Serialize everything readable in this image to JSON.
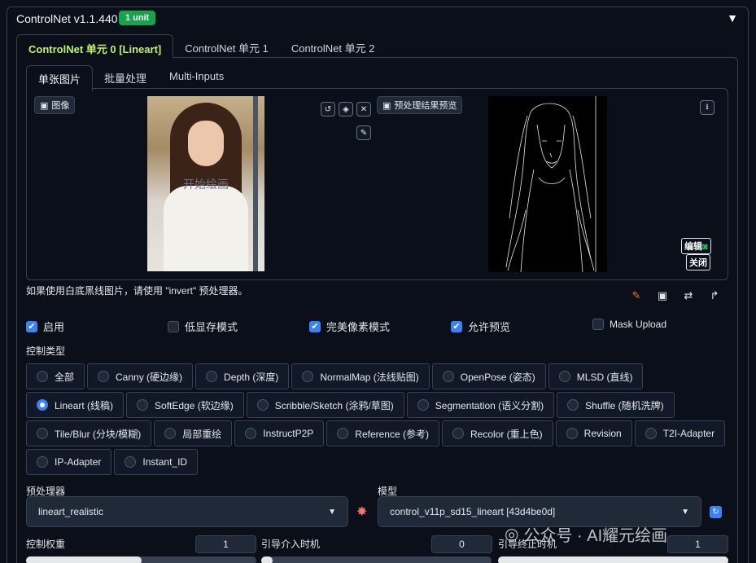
{
  "header": {
    "title": "ControlNet v1.1.440",
    "badge": "1 unit",
    "collapse_icon": "triangle-down-icon"
  },
  "unit_tabs": [
    "ControlNet 单元 0 [Lineart]",
    "ControlNet 单元 1",
    "ControlNet 单元 2"
  ],
  "sub_tabs": [
    "单张图片",
    "批量处理",
    "Multi-Inputs"
  ],
  "input_image": {
    "label": "图像",
    "overlay_text": "开始绘画"
  },
  "preview": {
    "label": "预处理结果预览",
    "edit_label": "编辑",
    "close_label": "关闭"
  },
  "hint": "如果使用白底黑线图片，请使用 \"invert\" 预处理器。",
  "checkboxes": [
    {
      "label": "启用",
      "checked": true
    },
    {
      "label": "低显存模式",
      "checked": false
    },
    {
      "label": "完美像素模式",
      "checked": true
    },
    {
      "label": "允许预览",
      "checked": true
    },
    {
      "label": "Mask Upload",
      "checked": false
    }
  ],
  "control_type": {
    "label": "控制类型",
    "options": [
      "全部",
      "Canny (硬边缘)",
      "Depth (深度)",
      "NormalMap (法线贴图)",
      "OpenPose (姿态)",
      "MLSD (直线)",
      "Lineart (线稿)",
      "SoftEdge (软边缘)",
      "Scribble/Sketch (涂鸦/草图)",
      "Segmentation (语义分割)",
      "Shuffle (随机洗牌)",
      "Tile/Blur (分块/模糊)",
      "局部重绘",
      "InstructP2P",
      "Reference (参考)",
      "Recolor (重上色)",
      "Revision",
      "T2I-Adapter",
      "IP-Adapter",
      "Instant_ID"
    ],
    "selected": "Lineart (线稿)"
  },
  "preprocessor": {
    "label": "预处理器",
    "value": "lineart_realistic"
  },
  "model": {
    "label": "模型",
    "value": "control_v11p_sd15_lineart [43d4be0d]"
  },
  "weight": {
    "label": "控制权重",
    "value": "1",
    "fraction": 0.5
  },
  "start": {
    "label": "引导介入时机",
    "value": "0",
    "fraction": 0.0
  },
  "end": {
    "label": "引导终止时机",
    "value": "1",
    "fraction": 1.0
  },
  "watermark": "公众号 · AI耀元绘画",
  "colors": {
    "accent": "#3b82f6",
    "active_tab": "#bef264",
    "badge": "#16a34a"
  }
}
